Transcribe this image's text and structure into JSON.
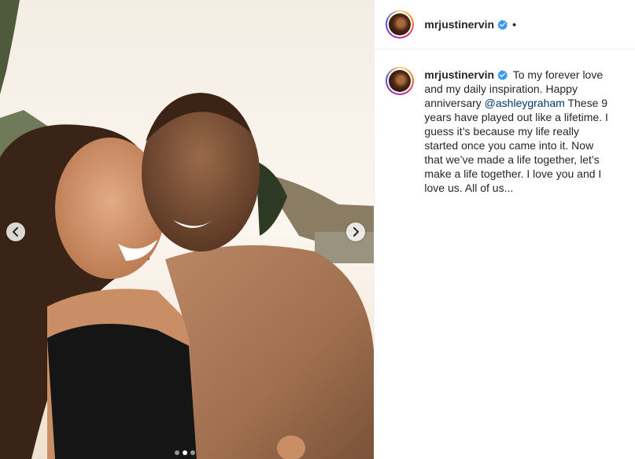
{
  "header": {
    "username": "mrjustinervin",
    "separator": "•"
  },
  "caption": {
    "username": "mrjustinervin",
    "text_before_mention": "To my forever love and my daily inspiration. Happy anniversary ",
    "mention": "@ashleygraham",
    "text_after_mention": " These 9 years have played out like a lifetime. I guess it’s because my life really started once you came into it. Now that we’ve made a life together, let’s make a life together. I love you and I love us. All of us..."
  },
  "carousel": {
    "slide_count": 3,
    "active_slide": 2
  },
  "colors": {
    "verified": "#3897f0",
    "mention": "#00376b",
    "text": "#262626"
  },
  "icons": [
    "verified-badge-icon",
    "chevron-left-icon",
    "chevron-right-icon"
  ]
}
